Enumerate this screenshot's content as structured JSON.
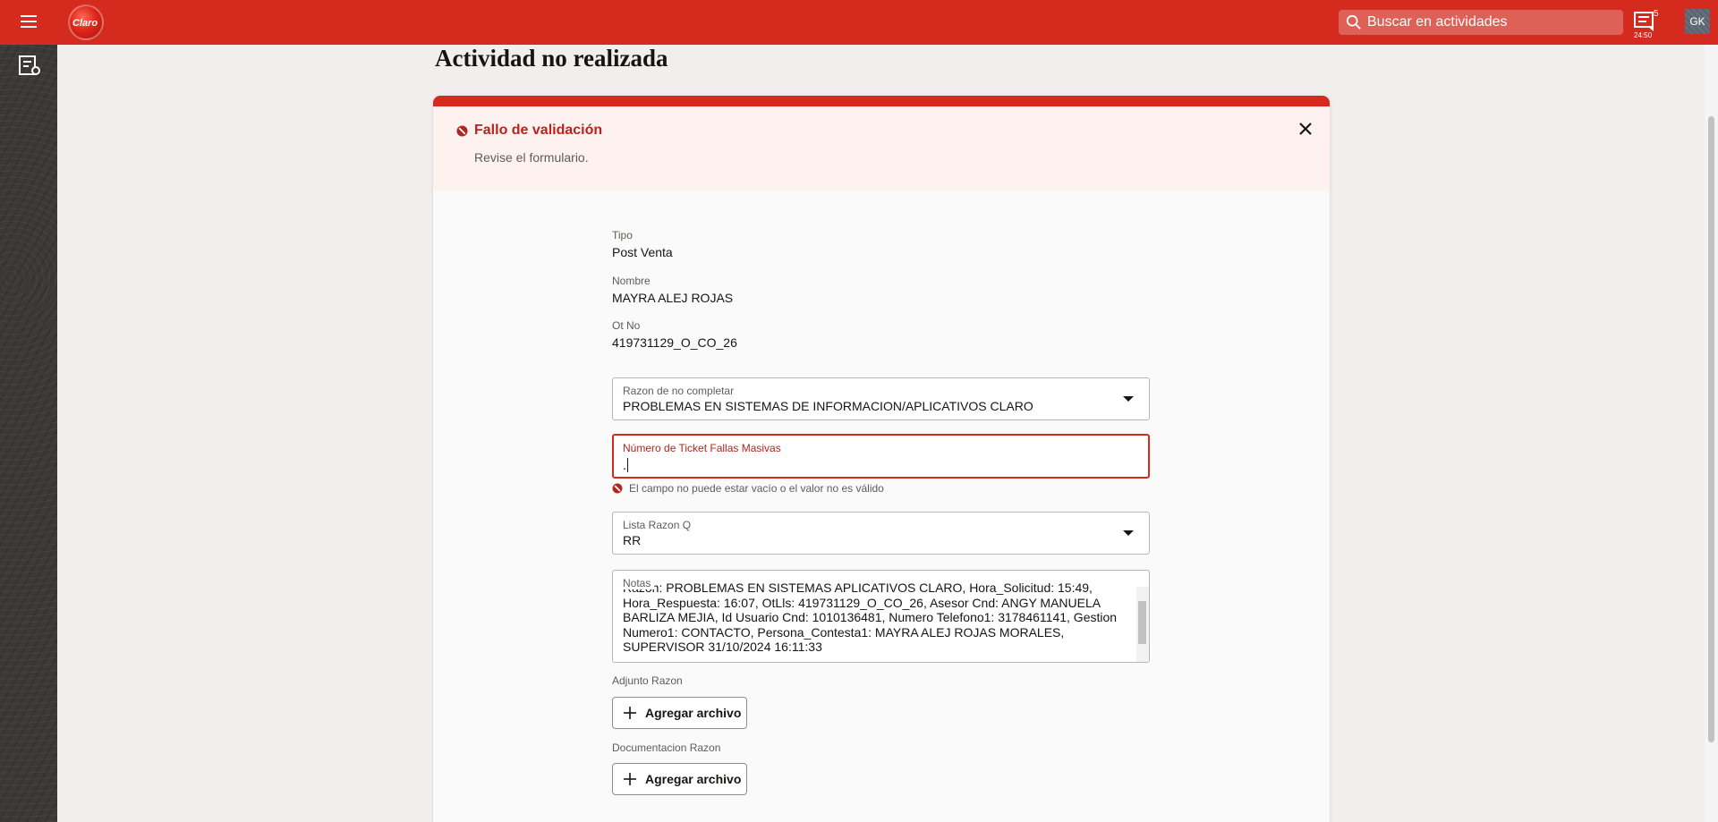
{
  "topbar": {
    "logo_text": "Claro",
    "search_placeholder": "Buscar en actividades",
    "notifications_count": "5",
    "notifications_time": "24:50",
    "avatar_initials": "GK"
  },
  "page": {
    "title": "Actividad no realizada"
  },
  "banner": {
    "title": "Fallo de validación",
    "subtitle": "Revise el formulario."
  },
  "info": {
    "tipo_label": "Tipo",
    "tipo_value": "Post Venta",
    "nombre_label": "Nombre",
    "nombre_value": "MAYRA ALEJ ROJAS",
    "ot_label": "Ot No",
    "ot_value": "419731129_O_CO_26"
  },
  "form": {
    "razon_label": "Razon de no completar",
    "razon_value": "PROBLEMAS EN SISTEMAS DE INFORMACION/APLICATIVOS CLARO",
    "ticket_label": "Número de Ticket Fallas Masivas",
    "ticket_value": ".",
    "ticket_error": "El campo no puede estar vacío o el valor no es válido",
    "lista_label": "Lista Razon Q",
    "lista_value": "RR",
    "notas_label": "Notas",
    "notas_value": "Razon: PROBLEMAS EN SISTEMAS APLICATIVOS CLARO, Hora_Solicitud: 15:49, Hora_Respuesta: 16:07, OtLls: 419731129_O_CO_26, Asesor Cnd: ANGY MANUELA BARLIZA MEJIA, Id Usuario Cnd: 1010136481, Numero Telefono1: 3178461141, Gestion Numero1: CONTACTO, Persona_Contesta1: MAYRA ALEJ ROJAS MORALES, SUPERVISOR 31/10/2024 16:11:33",
    "adjunto_label": "Adjunto Razon",
    "adjunto_button": "Agregar archivo",
    "documentacion_label": "Documentacion Razon",
    "documentacion_button": "Agregar archivo"
  },
  "colors": {
    "brand": "#d52b1e",
    "error": "#b3261e"
  }
}
